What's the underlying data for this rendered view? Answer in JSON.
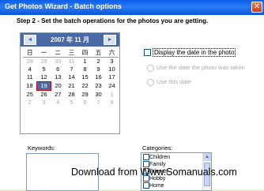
{
  "window": {
    "title": "Get Photos Wizard - Batch options"
  },
  "step_text": "Step 2 - Set the batch operations for the photos you are getting.",
  "calendar": {
    "month_label": "2007 年 11 月",
    "prev_symbol": "◄",
    "next_symbol": "►",
    "weekdays": [
      "日",
      "一",
      "二",
      "三",
      "四",
      "五",
      "六"
    ],
    "weeks": [
      [
        "28",
        "29",
        "30",
        "31",
        "1",
        "2",
        "3"
      ],
      [
        "4",
        "5",
        "6",
        "7",
        "8",
        "9",
        "10"
      ],
      [
        "11",
        "12",
        "13",
        "14",
        "15",
        "16",
        "17"
      ],
      [
        "18",
        "19",
        "20",
        "21",
        "22",
        "23",
        "24"
      ],
      [
        "25",
        "26",
        "27",
        "28",
        "29",
        "30",
        "1"
      ],
      [
        "2",
        "3",
        "4",
        "5",
        "6",
        "7",
        "8"
      ]
    ],
    "selected_day": "19"
  },
  "options": {
    "display_date_label": "Display the date in the photo",
    "radio_taken_label": "Use the date the photo was taken",
    "radio_this_label": "Use this date"
  },
  "keywords": {
    "label": "Keywords:"
  },
  "categories": {
    "label": "Categories:",
    "items": [
      "Children",
      "Family",
      "Friends",
      "Hobby",
      "Home"
    ]
  },
  "watermark": "Download from Www.Somanuals.com"
}
